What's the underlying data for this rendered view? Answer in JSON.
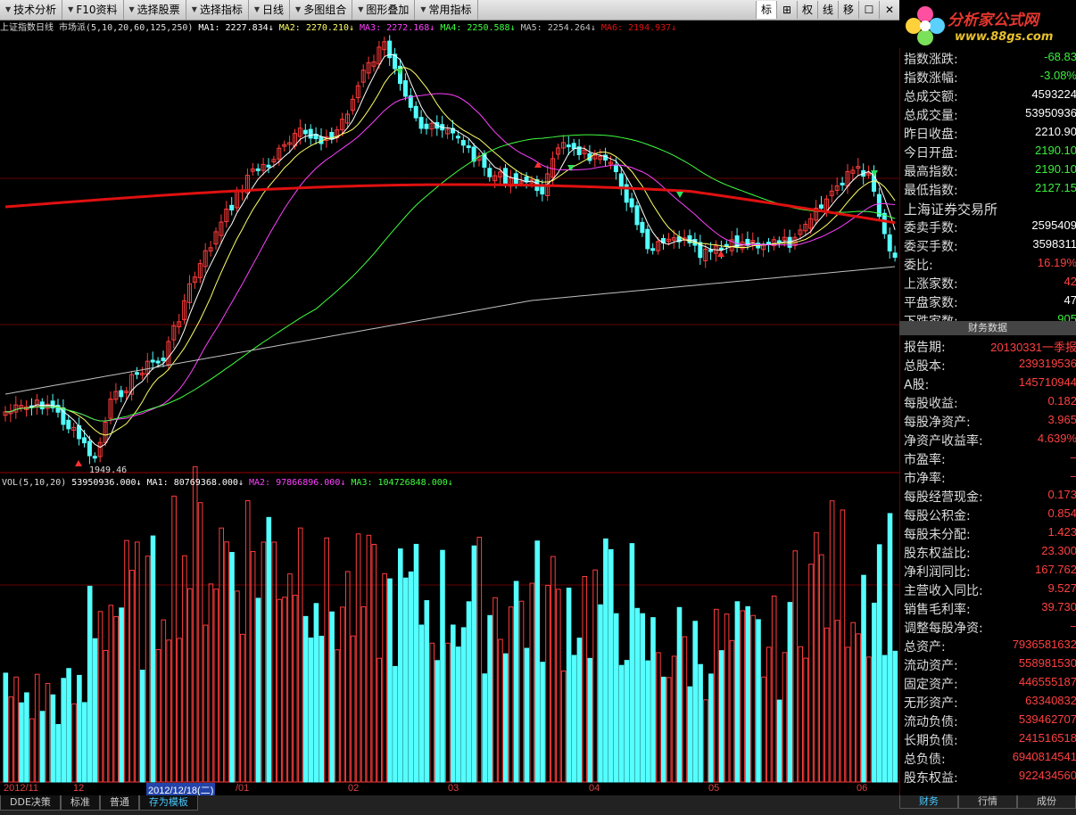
{
  "toolbar": {
    "items": [
      "技术分析",
      "F10资料",
      "选择股票",
      "选择指标",
      "日线",
      "多图组合",
      "图形叠加",
      "常用指标"
    ],
    "buttons": [
      "标",
      "⊞",
      "权",
      "线",
      "移",
      "☐",
      "✕"
    ]
  },
  "logo": {
    "name": "分析家公式网",
    "url": "www.88gs.com"
  },
  "infoline": {
    "title": "上证指数日线",
    "indicator": "市场派(5,10,20,60,125,250)",
    "ma1": "MA1: 2227.834↓",
    "ma2": "MA2: 2270.210↓",
    "ma3": "MA3: 2272.168↓",
    "ma4": "MA4: 2250.588↓",
    "ma5": "MA5: 2254.264↓",
    "ma6": "MA6: 2194.937↓"
  },
  "price_label_low": "1949.46",
  "vol_info": {
    "label": "VOL(5,10,20)",
    "vol": "53950936.000↓",
    "ma1": "MA1: 80769368.000↓",
    "ma2": "MA2: 97866896.000↓",
    "ma3": "MA3: 104726848.000↓"
  },
  "quote_rows": [
    {
      "label": "指数涨跌:",
      "value": "-68.83",
      "color": "green"
    },
    {
      "label": "指数涨幅:",
      "value": "-3.08%",
      "color": "green"
    },
    {
      "label": "总成交额:",
      "value": "4593224",
      "color": "white"
    },
    {
      "label": "总成交量:",
      "value": "53950936",
      "color": "white"
    },
    {
      "label": "昨日收盘:",
      "value": "2210.90",
      "color": "white"
    },
    {
      "label": "今日开盘:",
      "value": "2190.10",
      "color": "green"
    },
    {
      "label": "最高指数:",
      "value": "2190.10",
      "color": "green"
    },
    {
      "label": "最低指数:",
      "value": "2127.15",
      "color": "green"
    }
  ],
  "exchange_title": "上海证券交易所",
  "exchange_rows": [
    {
      "label": "委卖手数:",
      "value": "2595409",
      "color": "white"
    },
    {
      "label": "委买手数:",
      "value": "3598311",
      "color": "white"
    },
    {
      "label": "委比:",
      "value": "16.19%",
      "color": "red"
    },
    {
      "label": "上涨家数:",
      "value": "42",
      "color": "red"
    },
    {
      "label": "平盘家数:",
      "value": "47",
      "color": "white"
    },
    {
      "label": "下跌家数:",
      "value": "905",
      "color": "green"
    }
  ],
  "fin_header": "财务数据",
  "fin_rows": [
    {
      "label": "报告期:",
      "value": "20130331一季报"
    },
    {
      "label": "总股本:",
      "value": "239319536"
    },
    {
      "label": "A股:",
      "value": "145710944"
    },
    {
      "label": "每股收益:",
      "value": "0.182"
    },
    {
      "label": "每股净资产:",
      "value": "3.965"
    },
    {
      "label": "净资产收益率:",
      "value": "4.639%"
    },
    {
      "label": "市盈率:",
      "value": "–"
    },
    {
      "label": "市净率:",
      "value": "–"
    },
    {
      "label": "每股经营现金:",
      "value": "0.173"
    },
    {
      "label": "每股公积金:",
      "value": "0.854"
    },
    {
      "label": "每股未分配:",
      "value": "1.423"
    },
    {
      "label": "股东权益比:",
      "value": "23.300"
    },
    {
      "label": "净利润同比:",
      "value": "167.762"
    },
    {
      "label": "主营收入同比:",
      "value": "9.527"
    },
    {
      "label": "销售毛利率:",
      "value": "39.730"
    },
    {
      "label": "调整每股净资:",
      "value": "–"
    },
    {
      "label": "总资产:",
      "value": "7936581632"
    },
    {
      "label": "流动资产:",
      "value": "558981530"
    },
    {
      "label": "固定资产:",
      "value": "446555187"
    },
    {
      "label": "无形资产:",
      "value": "63340832"
    },
    {
      "label": "流动负债:",
      "value": "539462707"
    },
    {
      "label": "长期负债:",
      "value": "241516518"
    },
    {
      "label": "总负债:",
      "value": "6940814541"
    },
    {
      "label": "股东权益:",
      "value": "922434560"
    }
  ],
  "date_axis": [
    "2012/11",
    "12",
    "2012/12/18(二)",
    "/01",
    "02",
    "03",
    "04",
    "05",
    "06"
  ],
  "bottom_tabs": [
    "DDE决策",
    "标准",
    "普通",
    "存为模板"
  ],
  "right_tabs": [
    "财务",
    "行情",
    "成份"
  ],
  "colors": {
    "up": "#ff3c3c",
    "down": "#54ffff",
    "ma250": "#e01010",
    "ma1": "#ffffff",
    "ma2": "#ffff66",
    "ma3": "#ff40ff",
    "ma4": "#40ff40",
    "ma5": "#c0c0c0"
  }
}
